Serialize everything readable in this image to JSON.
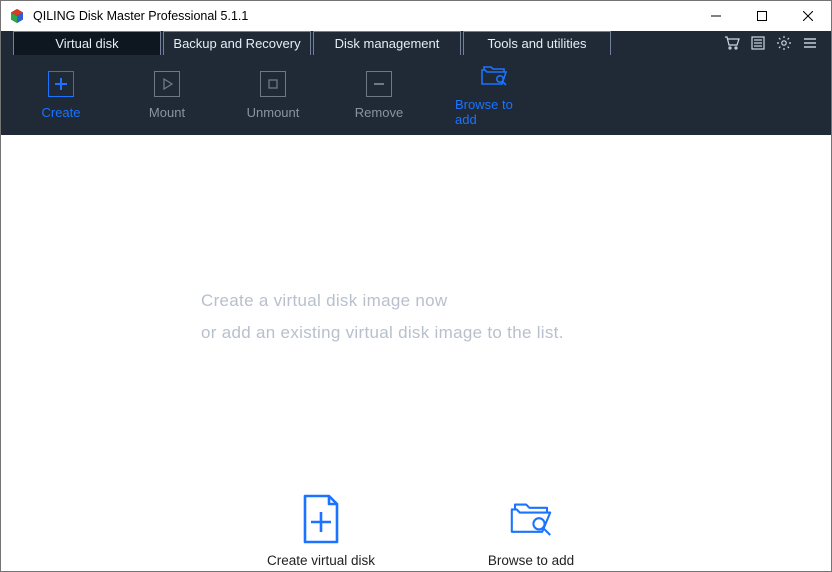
{
  "window": {
    "title": "QILING Disk Master Professional 5.1.1"
  },
  "tabs": [
    {
      "label": "Virtual disk",
      "active": true
    },
    {
      "label": "Backup and Recovery",
      "active": false
    },
    {
      "label": "Disk management",
      "active": false
    },
    {
      "label": "Tools and utilities",
      "active": false
    }
  ],
  "header_icons": [
    "cart-icon",
    "list-icon",
    "gear-icon",
    "menu-icon"
  ],
  "toolbar": {
    "create": "Create",
    "mount": "Mount",
    "unmount": "Unmount",
    "remove": "Remove",
    "browse": "Browse to add"
  },
  "content": {
    "line1": "Create a virtual disk image now",
    "line2": "or add an existing virtual disk image to the list.",
    "action_create": "Create virtual disk",
    "action_browse": "Browse to add"
  },
  "colors": {
    "accent": "#1b73ff",
    "dark": "#1f2a36",
    "muted": "#8a94a1"
  }
}
